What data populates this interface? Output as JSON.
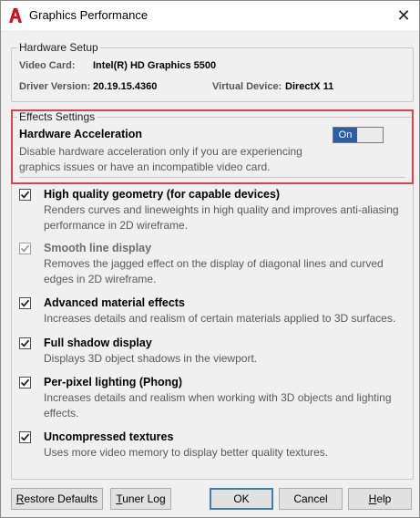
{
  "window": {
    "title": "Graphics Performance"
  },
  "hardware_setup": {
    "legend": "Hardware Setup",
    "video_card_label": "Video Card:",
    "video_card_value": "Intel(R) HD Graphics 5500",
    "driver_label": "Driver Version:",
    "driver_value": "20.19.15.4360",
    "virtual_device_label": "Virtual Device:",
    "virtual_device_value": "DirectX 11"
  },
  "effects": {
    "legend": "Effects Settings",
    "hw_accel_title": "Hardware Acceleration",
    "hw_accel_desc": "Disable hardware acceleration only if you are experiencing graphics issues or have an incompatible video card.",
    "toggle_label": "On",
    "toggle_state": true
  },
  "options": [
    {
      "title": "High quality geometry (for capable devices)",
      "desc": "Renders curves and lineweights in high quality and improves anti-aliasing performance in 2D wireframe.",
      "checked": true,
      "disabled": false
    },
    {
      "title": "Smooth line display",
      "desc": "Removes the jagged effect on the display of diagonal lines and curved edges in 2D wireframe.",
      "checked": true,
      "disabled": true
    },
    {
      "title": "Advanced material effects",
      "desc": "Increases details and realism of certain materials applied to 3D surfaces.",
      "checked": true,
      "disabled": false
    },
    {
      "title": "Full shadow display",
      "desc": "Displays 3D object shadows in the viewport.",
      "checked": true,
      "disabled": false
    },
    {
      "title": "Per-pixel lighting (Phong)",
      "desc": "Increases details and realism when working with 3D objects and lighting effects.",
      "checked": true,
      "disabled": false
    },
    {
      "title": "Uncompressed textures",
      "desc": "Uses more video memory to display better quality textures.",
      "checked": true,
      "disabled": false
    }
  ],
  "buttons": {
    "restore_defaults_first": "R",
    "restore_defaults_rest": "estore Defaults",
    "tuner_log_first": "T",
    "tuner_log_rest": "uner Log",
    "ok": "OK",
    "cancel": "Cancel",
    "help_first": "H",
    "help_rest": "elp"
  },
  "colors": {
    "accent_red": "#d9434a",
    "toggle_blue": "#2a5fa8"
  }
}
